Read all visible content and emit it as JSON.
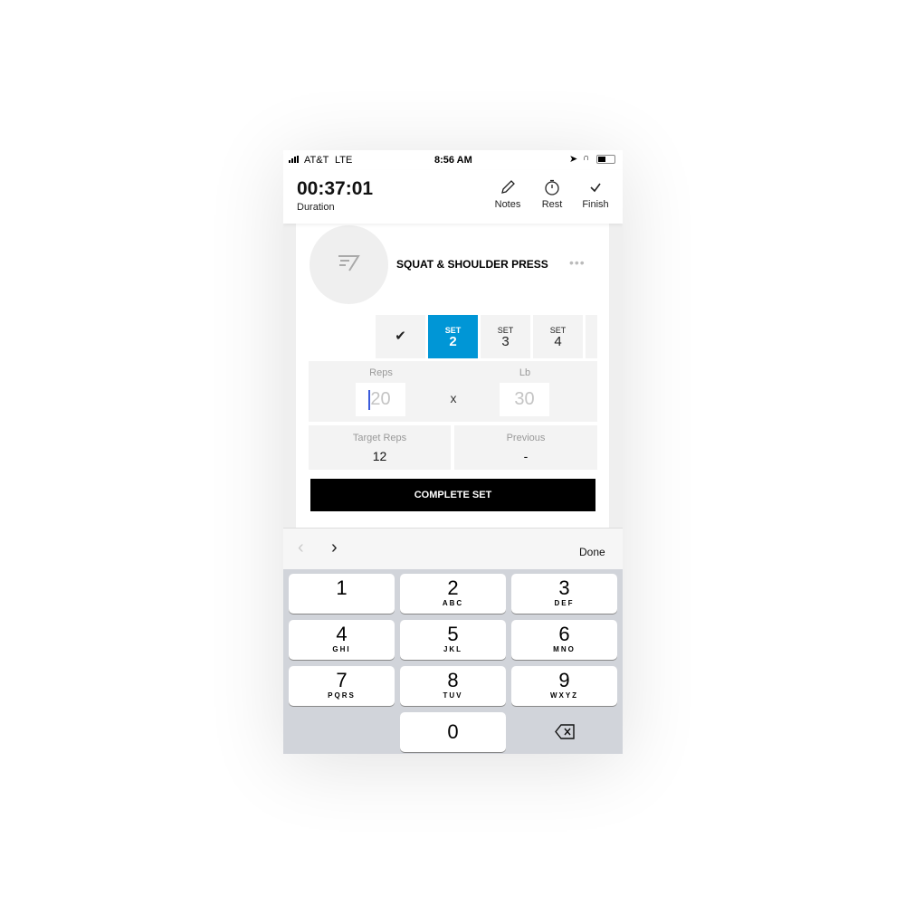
{
  "status_bar": {
    "carrier": "AT&T",
    "network": "LTE",
    "time": "8:56 AM"
  },
  "header": {
    "duration": "00:37:01",
    "duration_label": "Duration",
    "notes": "Notes",
    "rest": "Rest",
    "finish": "Finish"
  },
  "exercise": {
    "title": "SQUAT & SHOULDER PRESS"
  },
  "sets": [
    {
      "label": "SET",
      "number": "2",
      "active": true
    },
    {
      "label": "SET",
      "number": "3"
    },
    {
      "label": "SET",
      "number": "4"
    }
  ],
  "accent": "#0096d6",
  "entry": {
    "reps_label": "Reps",
    "reps_placeholder": "20",
    "times": "x",
    "lb_label": "Lb",
    "lb_placeholder": "30"
  },
  "info": {
    "target_label": "Target Reps",
    "target_value": "12",
    "previous_label": "Previous",
    "previous_value": "-"
  },
  "complete_button": "COMPLETE SET",
  "accessory": {
    "done": "Done"
  },
  "keys": [
    {
      "d": "1",
      "l": ""
    },
    {
      "d": "2",
      "l": "ABC"
    },
    {
      "d": "3",
      "l": "DEF"
    },
    {
      "d": "4",
      "l": "GHI"
    },
    {
      "d": "5",
      "l": "JKL"
    },
    {
      "d": "6",
      "l": "MNO"
    },
    {
      "d": "7",
      "l": "PQRS"
    },
    {
      "d": "8",
      "l": "TUV"
    },
    {
      "d": "9",
      "l": "WXYZ"
    },
    {
      "d": "0",
      "l": ""
    }
  ]
}
